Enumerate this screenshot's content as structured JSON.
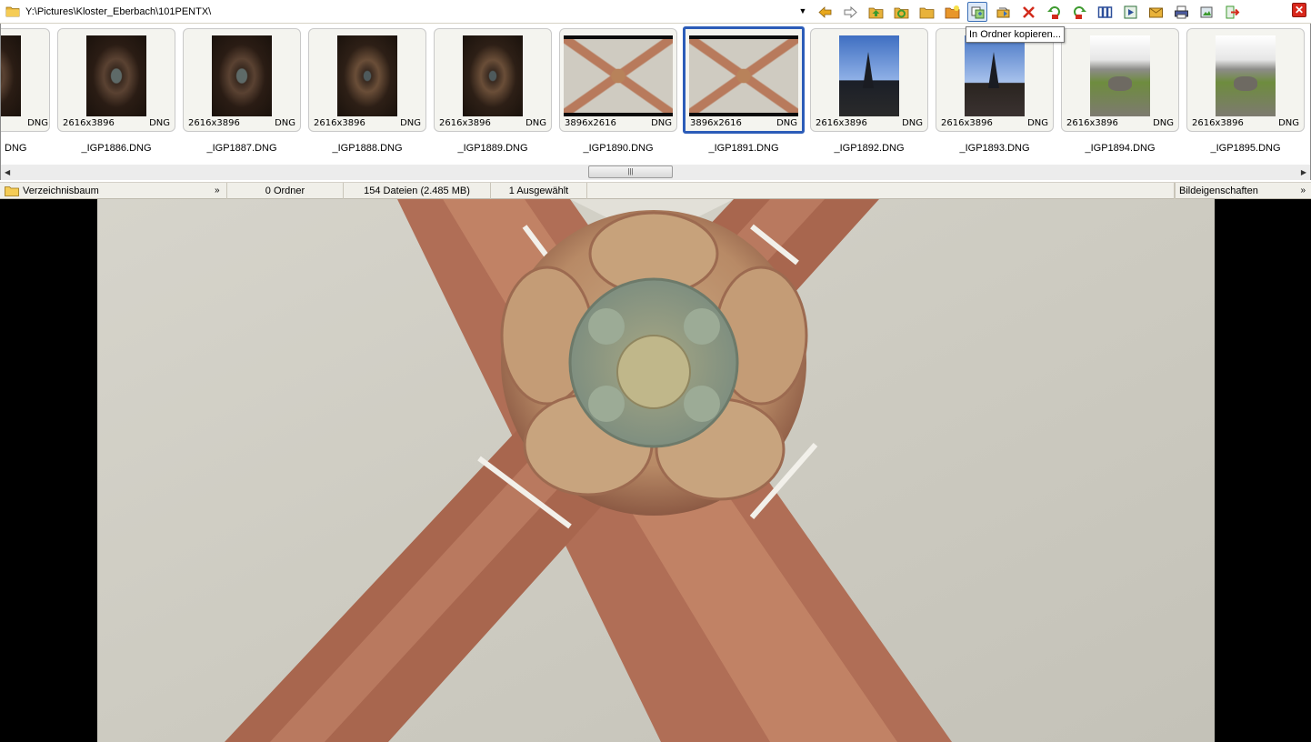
{
  "address_bar": {
    "path": "Y:\\Pictures\\Kloster_Eberbach\\101PENTX\\"
  },
  "toolbar": {
    "buttons": [
      {
        "icon": "arrow-left-icon",
        "color": "#e8a81c"
      },
      {
        "icon": "arrow-right-icon",
        "color": "#e8a81c"
      },
      {
        "icon": "folder-up-icon",
        "color": "#3d9a2e"
      },
      {
        "icon": "refresh-folder-icon",
        "color": "#3d9a2e"
      },
      {
        "icon": "folder-icon",
        "color": "#e8b23a"
      },
      {
        "icon": "new-folder-icon",
        "color": "#e8962a"
      },
      {
        "icon": "copy-to-folder-icon",
        "color": "#3b6fb6",
        "active": true
      },
      {
        "icon": "move-to-folder-icon",
        "color": "#3b6fb6"
      },
      {
        "icon": "delete-icon",
        "color": "#d22b1c"
      },
      {
        "icon": "rotate-left-icon",
        "color": "#3d9a2e"
      },
      {
        "icon": "rotate-right-icon",
        "color": "#3d9a2e"
      },
      {
        "icon": "compare-icon",
        "color": "#2d4f9a"
      },
      {
        "icon": "slideshow-icon",
        "color": "#2d6f3a"
      },
      {
        "icon": "email-icon",
        "color": "#e8b23a"
      },
      {
        "icon": "print-icon",
        "color": "#4a5aa0"
      },
      {
        "icon": "edit-image-icon",
        "color": "#3d9a2e"
      },
      {
        "icon": "exit-icon",
        "color": "#3d9a2e"
      }
    ],
    "tooltip": "In Ordner kopieren...",
    "close_icon": "close-icon"
  },
  "thumbnails": [
    {
      "name": "DNG",
      "dims": "",
      "type": "",
      "kind": "door",
      "partial": true
    },
    {
      "name": "_IGP1886.DNG",
      "dims": "2616x3896",
      "type": "DNG",
      "kind": "door"
    },
    {
      "name": "_IGP1887.DNG",
      "dims": "2616x3896",
      "type": "DNG",
      "kind": "door"
    },
    {
      "name": "_IGP1888.DNG",
      "dims": "2616x3896",
      "type": "DNG",
      "kind": "door-b"
    },
    {
      "name": "_IGP1889.DNG",
      "dims": "2616x3896",
      "type": "DNG",
      "kind": "door-b"
    },
    {
      "name": "_IGP1890.DNG",
      "dims": "3896x2616",
      "type": "DNG",
      "kind": "vault"
    },
    {
      "name": "_IGP1891.DNG",
      "dims": "3896x2616",
      "type": "DNG",
      "kind": "vault",
      "selected": true
    },
    {
      "name": "_IGP1892.DNG",
      "dims": "2616x3896",
      "type": "DNG",
      "kind": "church"
    },
    {
      "name": "_IGP1893.DNG",
      "dims": "2616x3896",
      "type": "DNG",
      "kind": "church-b"
    },
    {
      "name": "_IGP1894.DNG",
      "dims": "2616x3896",
      "type": "DNG",
      "kind": "court"
    },
    {
      "name": "_IGP1895.DNG",
      "dims": "2616x3896",
      "type": "DNG",
      "kind": "court"
    }
  ],
  "status_bar": {
    "tree_label": "Verzeichnisbaum",
    "folders": "0 Ordner",
    "files": "154 Dateien (2.485 MB)",
    "selected": "1 Ausgewählt",
    "properties_label": "Bildeigenschaften"
  },
  "colors": {
    "selection_border": "#2c5cb8",
    "viewer_background": "#000000",
    "status_bar_background": "#f0efe9"
  }
}
